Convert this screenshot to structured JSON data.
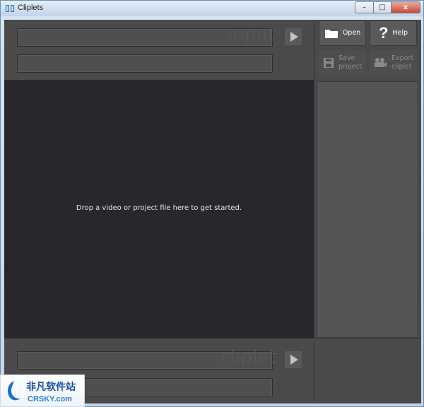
{
  "window": {
    "title": "Cliplets",
    "controls": {
      "minimize": "–",
      "maximize": "□",
      "close": "x"
    }
  },
  "input_panel": {
    "watermark": "input",
    "field_top_value": "",
    "field_bottom_value": ""
  },
  "dropzone": {
    "message": "Drop a video or project file here to get started."
  },
  "cliplet_panel": {
    "watermark": "cliplet",
    "field_top_value": "",
    "field_bottom_value": ""
  },
  "actions": {
    "open": {
      "label": "Open",
      "icon": "folder-icon",
      "enabled": true
    },
    "help": {
      "label": "Help",
      "icon": "question-icon",
      "enabled": true
    },
    "save": {
      "label_line1": "Save",
      "label_line2": "project",
      "icon": "floppy-disk-icon",
      "enabled": false
    },
    "export": {
      "label_line1": "Export",
      "label_line2": "cliplet",
      "icon": "film-camera-icon",
      "enabled": false
    }
  },
  "logo_overlay": {
    "cn_text": "非凡软件站",
    "en_text": "CRSKY.com"
  },
  "colors": {
    "panel": "#4a4a4a",
    "dropzone": "#28272b",
    "accent_close": "#c74a33"
  }
}
